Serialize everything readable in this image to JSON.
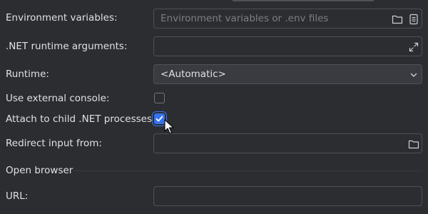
{
  "env_vars": {
    "label": "Environment variables:",
    "placeholder": "Environment variables or .env files",
    "icons": [
      "folder-icon",
      "document-icon"
    ]
  },
  "runtime_args": {
    "label": ".NET runtime arguments:",
    "value": "",
    "icon": "expand-icon"
  },
  "runtime": {
    "label": "Runtime:",
    "selected": "<Automatic>",
    "icon": "chevron-down-icon"
  },
  "external_console": {
    "label": "Use external console:",
    "checked": false
  },
  "attach_child": {
    "label": "Attach to child .NET processes:",
    "checked": true
  },
  "redirect_input": {
    "label": "Redirect input from:",
    "value": "",
    "icon": "folder-icon"
  },
  "open_browser": {
    "section_title": "Open browser"
  },
  "url": {
    "label": "URL:",
    "value": ""
  },
  "colors": {
    "background": "#2b2d30",
    "field_border": "#4e5157",
    "accent": "#3574f0",
    "text": "#dfe1e5",
    "placeholder": "#7c7f86"
  }
}
